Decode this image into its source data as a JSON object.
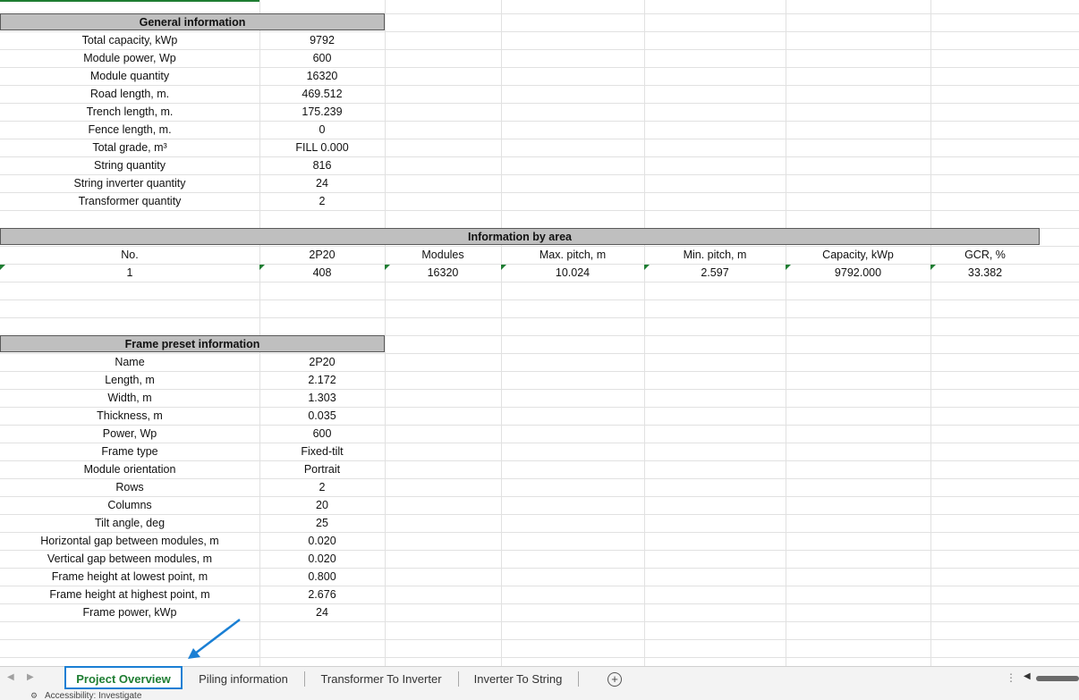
{
  "general": {
    "title": "General information",
    "rows": [
      {
        "label": "Total capacity, kWp",
        "value": "9792"
      },
      {
        "label": "Module power, Wp",
        "value": "600"
      },
      {
        "label": "Module quantity",
        "value": "16320"
      },
      {
        "label": "Road length, m.",
        "value": "469.512"
      },
      {
        "label": "Trench length, m.",
        "value": "175.239"
      },
      {
        "label": "Fence length, m.",
        "value": "0"
      },
      {
        "label": "Total grade, m³",
        "value": "FILL 0.000"
      },
      {
        "label": "String quantity",
        "value": "816"
      },
      {
        "label": "String inverter quantity",
        "value": "24"
      },
      {
        "label": "Transformer quantity",
        "value": "2"
      }
    ]
  },
  "area": {
    "title": "Information by area",
    "headers": [
      "No.",
      "2P20",
      "Modules",
      "Max. pitch, m",
      "Min. pitch, m",
      "Capacity, kWp",
      "GCR, %"
    ],
    "row": [
      "1",
      "408",
      "16320",
      "10.024",
      "2.597",
      "9792.000",
      "33.382"
    ]
  },
  "frame": {
    "title": "Frame preset information",
    "rows": [
      {
        "label": "Name",
        "value": "2P20"
      },
      {
        "label": "Length, m",
        "value": "2.172"
      },
      {
        "label": "Width, m",
        "value": "1.303"
      },
      {
        "label": "Thickness, m",
        "value": "0.035"
      },
      {
        "label": "Power, Wp",
        "value": "600"
      },
      {
        "label": "Frame type",
        "value": "Fixed-tilt"
      },
      {
        "label": "Module orientation",
        "value": "Portrait"
      },
      {
        "label": "Rows",
        "value": "2"
      },
      {
        "label": "Columns",
        "value": "20"
      },
      {
        "label": "Tilt angle, deg",
        "value": "25"
      },
      {
        "label": "Horizontal gap between modules, m",
        "value": "0.020"
      },
      {
        "label": "Vertical gap between modules, m",
        "value": "0.020"
      },
      {
        "label": "Frame height at lowest point, m",
        "value": "0.800"
      },
      {
        "label": "Frame height at highest point, m",
        "value": "2.676"
      },
      {
        "label": "Frame power, kWp",
        "value": "24"
      }
    ]
  },
  "tabs": [
    "Project Overview",
    "Piling information",
    "Transformer To Inverter",
    "Inverter To String"
  ],
  "active_tab": "Project Overview",
  "status_text": "Accessibility: Investigate",
  "colors": {
    "accent_green": "#1e7d32",
    "highlight_blue": "#1a7fd4",
    "header_gray": "#bfbfbf"
  }
}
